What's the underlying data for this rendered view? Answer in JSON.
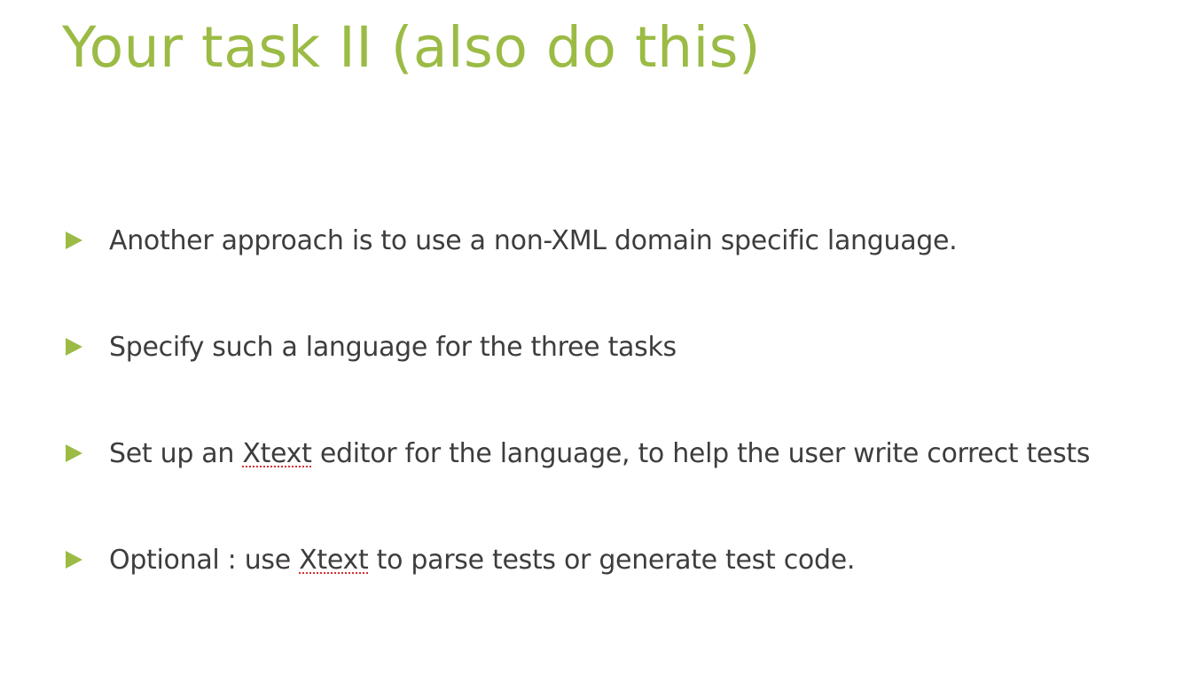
{
  "slide": {
    "title": "Your task II (also do this)",
    "bullets": [
      {
        "parts": [
          "Another approach is to use a non-XML domain specific language."
        ]
      },
      {
        "parts": [
          "Specify such a language for the three tasks"
        ]
      },
      {
        "parts": [
          "Set up an ",
          "Xtext",
          " editor for the language, to help the user write correct tests"
        ]
      },
      {
        "parts": [
          "Optional : use ",
          "Xtext",
          " to parse tests or generate test code."
        ]
      }
    ]
  },
  "colors": {
    "accent": "#9bbb45",
    "text": "#3d3d3d",
    "spellcheck_underline": "#d62f2f"
  },
  "icons": {
    "bullet_marker": "triangle-right-icon"
  }
}
